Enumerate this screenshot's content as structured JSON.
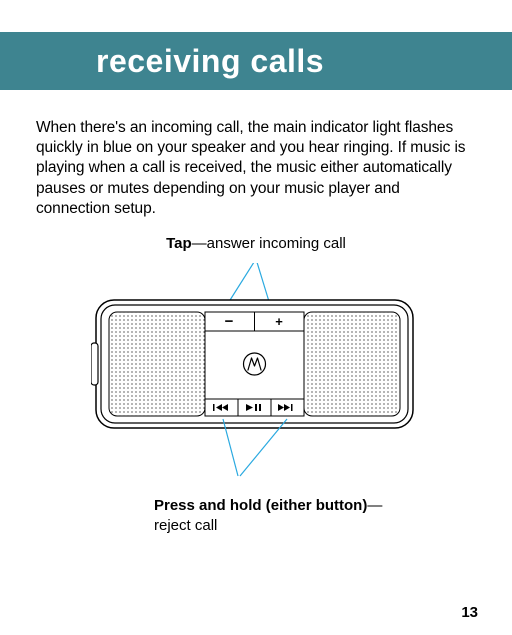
{
  "header": {
    "title": "receiving calls"
  },
  "body": {
    "paragraph": "When there's an incoming call, the main indicator light flashes quickly in blue on your speaker and you hear ringing. If music is playing when a call is received, the music either automatically pauses or mutes depending on your music player and connection setup."
  },
  "figure": {
    "top_callout_bold": "Tap",
    "top_callout_rest": "—answer incoming call",
    "bottom_callout_bold": "Press and hold (either button)",
    "bottom_callout_rest": "—reject call",
    "icons": {
      "minus": "−",
      "plus": "+",
      "prev": "⏮",
      "playpause": "⏯",
      "next": "⏭"
    }
  },
  "page_number": "13"
}
